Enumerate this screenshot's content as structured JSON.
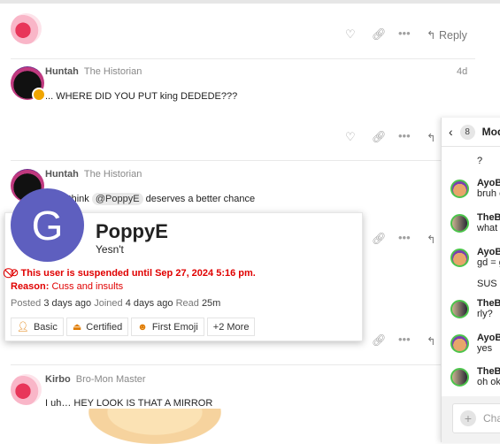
{
  "posts": [
    {
      "reply_label": "Reply"
    },
    {
      "username": "Huntah",
      "user_title": "The Historian",
      "date": "4d",
      "text": "... WHERE DID YOU PUT king DEDEDE???"
    },
    {
      "username": "Huntah",
      "user_title": "The Historian",
      "text_before": "...ill think",
      "mention": "@PoppyE",
      "text_after": "deserves a better chance"
    },
    {
      "username": "Kirbo",
      "user_title": "Bro-Mon Master",
      "text": "I uh… HEY LOOK IS THAT A MIRROR"
    }
  ],
  "user_card": {
    "avatar_letter": "G",
    "avatar_color": "#5e5fbf",
    "username": "PoppyE",
    "bio": "Yesn't",
    "suspended_text": "This user is suspended until Sep 27, 2024 5:16 pm.",
    "reason_label": "Reason:",
    "reason": "Cuss and insults",
    "posted_label": "Posted",
    "posted": "3 days ago",
    "joined_label": "Joined",
    "joined": "4 days ago",
    "read_label": "Read",
    "read": "25m",
    "badges": [
      {
        "label": "Basic",
        "icon": "user-icon"
      },
      {
        "label": "Certified",
        "icon": "certified-icon"
      },
      {
        "label": "First Emoji",
        "icon": "smile-icon"
      },
      {
        "label": "+2 More"
      }
    ]
  },
  "chat": {
    "count": "8",
    "channel": "Mod",
    "messages": [
      {
        "text": "?"
      },
      {
        "user": "AyoBi",
        "text": "bruh c"
      },
      {
        "user": "TheBa",
        "text": "what"
      },
      {
        "user": "AyoBi",
        "text": "gd = g"
      },
      {
        "text": "SUS a"
      },
      {
        "user": "TheBa",
        "text": "rly?"
      },
      {
        "user": "AyoBi",
        "text": "yes"
      },
      {
        "user": "TheBa",
        "text": "oh ok"
      }
    ],
    "input_placeholder": "Chat"
  },
  "colors": {
    "danger": "#e00000",
    "badge_icon": "#e07b00"
  }
}
